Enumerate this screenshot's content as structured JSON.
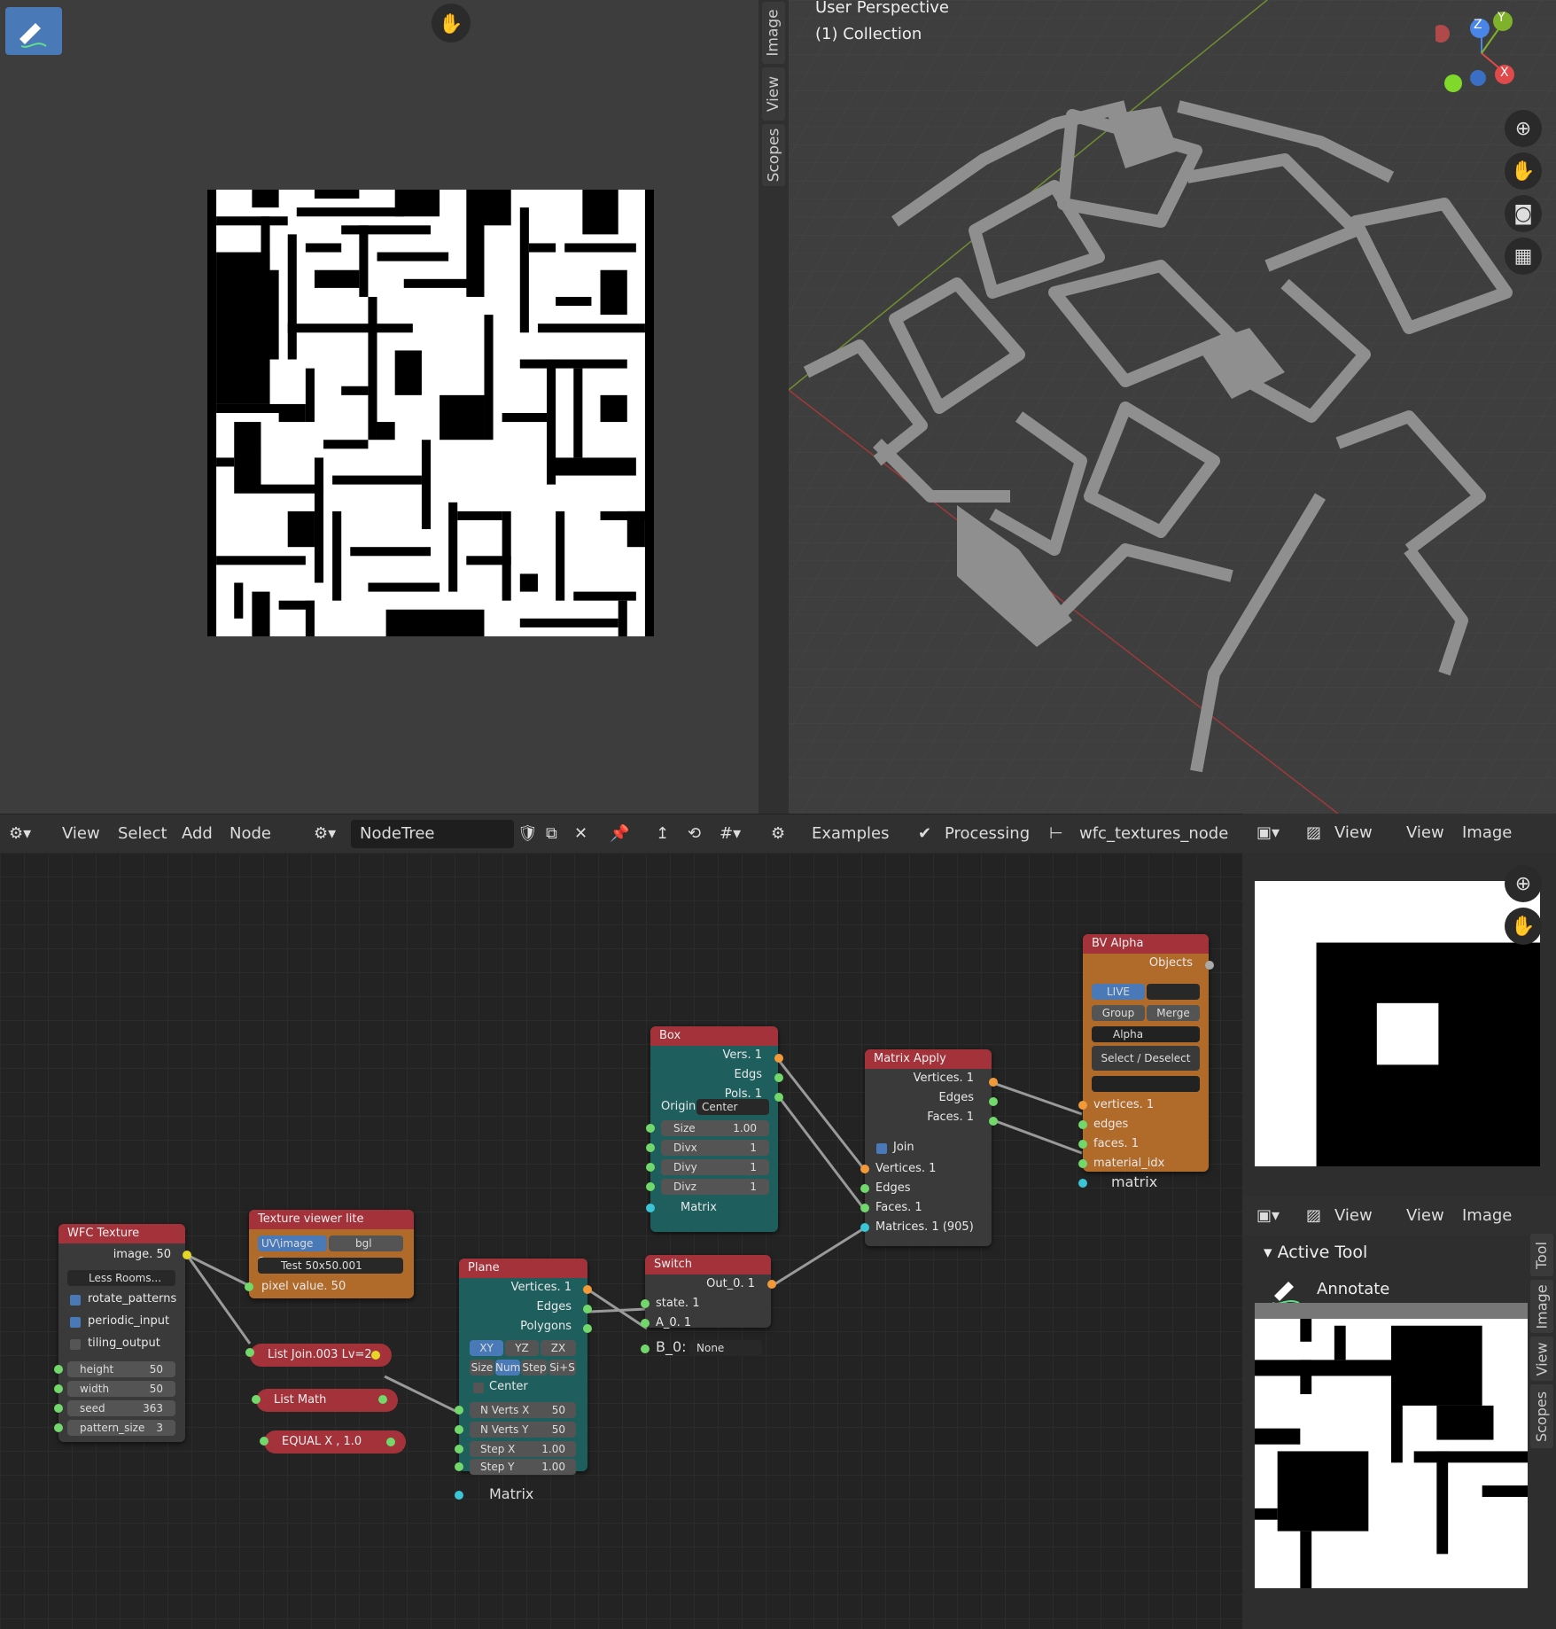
{
  "image_editor": {
    "side_tabs": [
      "Image",
      "View",
      "Scopes"
    ]
  },
  "viewport": {
    "title": "User Perspective",
    "collection": "(1) Collection",
    "gizmo": {
      "z": "Z",
      "y": "Y",
      "x": "X"
    }
  },
  "node_header": {
    "menu": [
      "View",
      "Select",
      "Add",
      "Node"
    ],
    "tree_name": "NodeTree",
    "examples": "Examples",
    "processing": "Processing",
    "tree_path": "wfc_textures_node"
  },
  "image_header": {
    "view": "View",
    "view2": "View",
    "image": "Image"
  },
  "image_header2": {
    "view": "View",
    "view2": "View",
    "image": "Image"
  },
  "nodes": {
    "wfc": {
      "title": "WFC Texture",
      "output": "image. 50",
      "image_name": "Less Rooms...",
      "rotate_patterns": "rotate_patterns",
      "periodic_input": "periodic_input",
      "tiling_output": "tiling_output",
      "height_label": "height",
      "height": "50",
      "width_label": "width",
      "width": "50",
      "seed_label": "seed",
      "seed": "363",
      "pattern_label": "pattern_size",
      "pattern": "3"
    },
    "texview": {
      "title": "Texture viewer lite",
      "uv": "UV\\image e...",
      "bgl": "bgl",
      "image": "Test 50x50.001",
      "pixel": "pixel value. 50"
    },
    "listjoin": "List Join.003 Lv=2",
    "listmath": "List Math",
    "equal": "EQUAL X ,  1.0",
    "plane": {
      "title": "Plane",
      "vertices": "Vertices. 1",
      "edges": "Edges",
      "polygons": "Polygons",
      "modes": [
        "XY",
        "YZ",
        "ZX"
      ],
      "dims": [
        "Size",
        "Num",
        "Step",
        "Si+S"
      ],
      "center": "Center",
      "nvx_label": "N Verts X",
      "nvx": "50",
      "nvy_label": "N Verts Y",
      "nvy": "50",
      "stepx_label": "Step X",
      "stepx": "1.00",
      "stepy_label": "Step Y",
      "stepy": "1.00",
      "matrix": "Matrix"
    },
    "box": {
      "title": "Box",
      "vers": "Vers. 1",
      "edgs": "Edgs",
      "pols": "Pols. 1",
      "origin_label": "Origin:",
      "origin": "Center",
      "size_label": "Size",
      "size": "1.00",
      "divx_label": "Divx",
      "divx": "1",
      "divy_label": "Divy",
      "divy": "1",
      "divz_label": "Divz",
      "divz": "1",
      "matrix": "Matrix"
    },
    "switch": {
      "title": "Switch",
      "out": "Out_0. 1",
      "state": "state. 1",
      "a": "A_0. 1",
      "b_label": "B_0:",
      "b": "None"
    },
    "matrix_apply": {
      "title": "Matrix Apply",
      "vertices": "Vertices. 1",
      "edges": "Edges",
      "faces": "Faces. 1",
      "join": "Join",
      "in_vertices": "Vertices. 1",
      "in_edges": "Edges",
      "in_faces": "Faces. 1",
      "matrices": "Matrices. 1 (905)"
    },
    "bv_alpha": {
      "title": "BV Alpha",
      "objects": "Objects",
      "live": "LIVE",
      "group": "Group",
      "merge": "Merge",
      "alpha": "Alpha",
      "select": "Select / Deselect",
      "vertices": "vertices. 1",
      "edges": "edges",
      "faces": "faces. 1",
      "material": "material_idx",
      "matrix": "matrix"
    }
  },
  "tool_panel": {
    "section": "Active Tool",
    "tool": "Annotate",
    "tabs": [
      "Tool",
      "Image",
      "View",
      "Scopes"
    ]
  },
  "colors": {
    "node_red": "#a3323a",
    "node_teal": "#1e5f5e",
    "node_orange": "#b06a2a",
    "accent_blue": "#4a79b8"
  }
}
